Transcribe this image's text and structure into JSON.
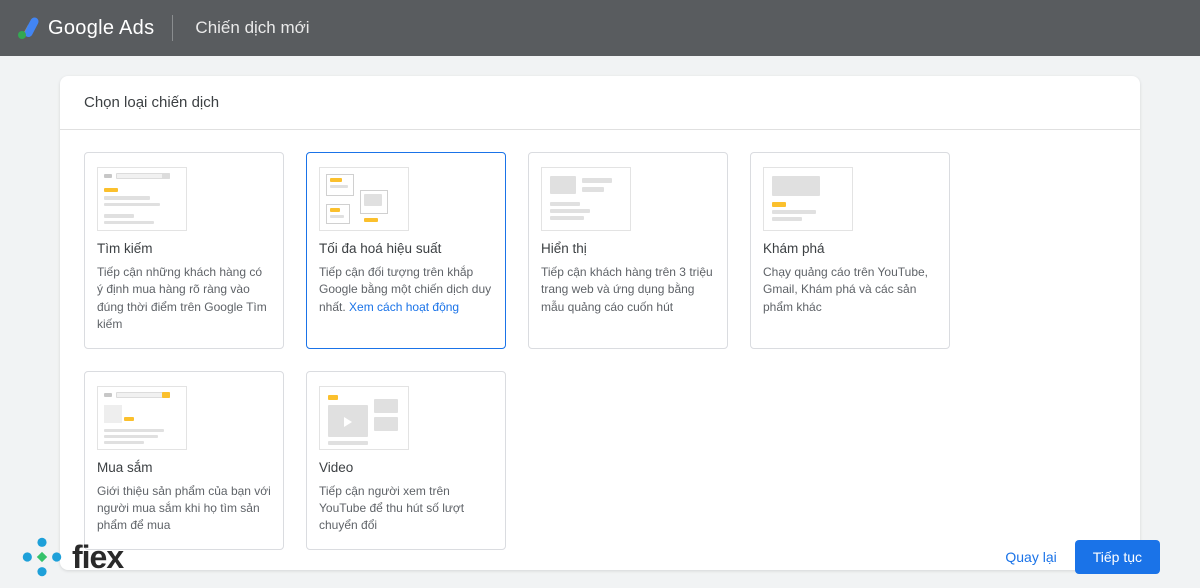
{
  "header": {
    "product": "Google Ads",
    "title": "Chiến dịch mới"
  },
  "section_title": "Chọn loại chiến dịch",
  "tiles": [
    {
      "title": "Tìm kiếm",
      "desc": "Tiếp cận những khách hàng có ý định mua hàng rõ ràng vào đúng thời điểm trên Google Tìm kiếm"
    },
    {
      "title": "Tối đa hoá hiệu suất",
      "desc": "Tiếp cận đối tượng trên khắp Google bằng một chiến dịch duy nhất. ",
      "link": "Xem cách hoạt động"
    },
    {
      "title": "Hiển thị",
      "desc": "Tiếp cận khách hàng trên 3 triệu trang web và ứng dụng bằng mẫu quảng cáo cuốn hút"
    },
    {
      "title": "Khám phá",
      "desc": "Chạy quảng cáo trên YouTube, Gmail, Khám phá và các sản phẩm khác"
    },
    {
      "title": "Mua sắm",
      "desc": "Giới thiệu sản phẩm của bạn với người mua sắm khi họ tìm sản phẩm để mua"
    },
    {
      "title": "Video",
      "desc": "Tiếp cận người xem trên YouTube để thu hút số lượt chuyển đổi"
    }
  ],
  "footer_logo_text": "fiex",
  "buttons": {
    "back": "Quay lại",
    "next": "Tiếp tục"
  },
  "selected_index": 1
}
